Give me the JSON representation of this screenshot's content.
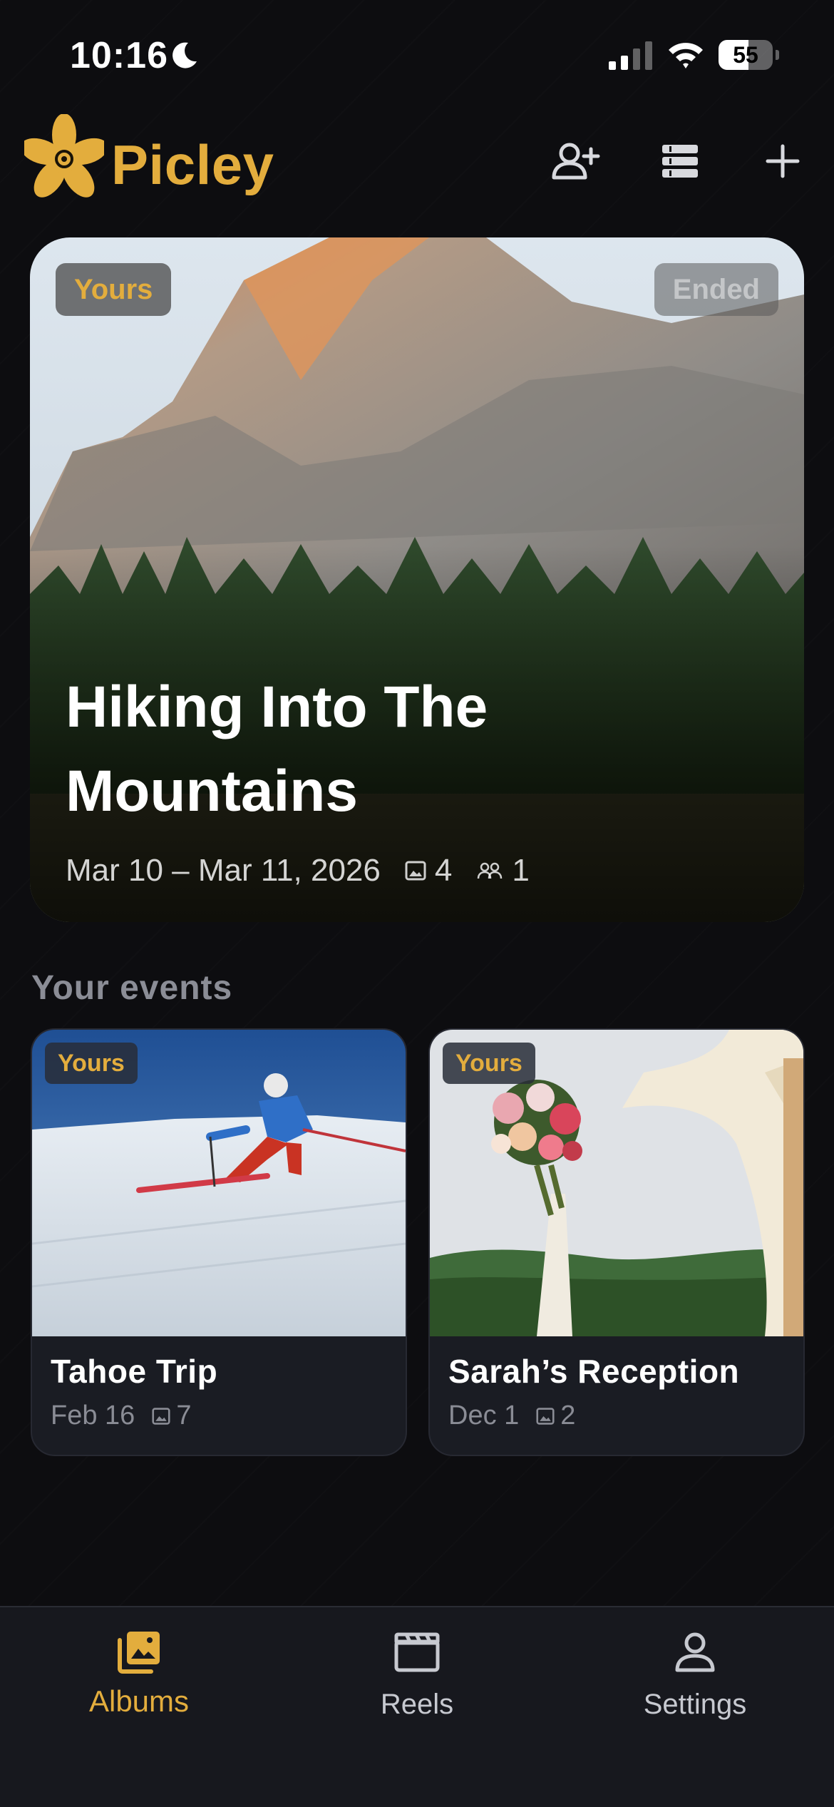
{
  "status_bar": {
    "time": "10:16",
    "battery": "55",
    "battery_level": 0.55
  },
  "header": {
    "app_name": "Picley",
    "brand_color": "#e3ad3d",
    "actions": [
      "invite-user-icon",
      "list-icon",
      "plus-icon"
    ]
  },
  "featured": {
    "badge_owner": "Yours",
    "badge_status": "Ended",
    "title": "Hiking Into The Mountains",
    "dates": "Mar 10 – Mar 11, 2026",
    "photo_count": "4",
    "member_count": "1"
  },
  "section": {
    "title": "Your events"
  },
  "events": [
    {
      "badge": "Yours",
      "title": "Tahoe Trip",
      "date": "Feb 16",
      "photo_count": "7"
    },
    {
      "badge": "Yours",
      "title": "Sarah’s Reception",
      "date": "Dec 1",
      "photo_count": "2"
    }
  ],
  "nav": {
    "items": [
      {
        "label": "Albums",
        "icon": "albums-icon",
        "active": true
      },
      {
        "label": "Reels",
        "icon": "clapperboard-icon",
        "active": false
      },
      {
        "label": "Settings",
        "icon": "user-icon",
        "active": false
      }
    ]
  }
}
